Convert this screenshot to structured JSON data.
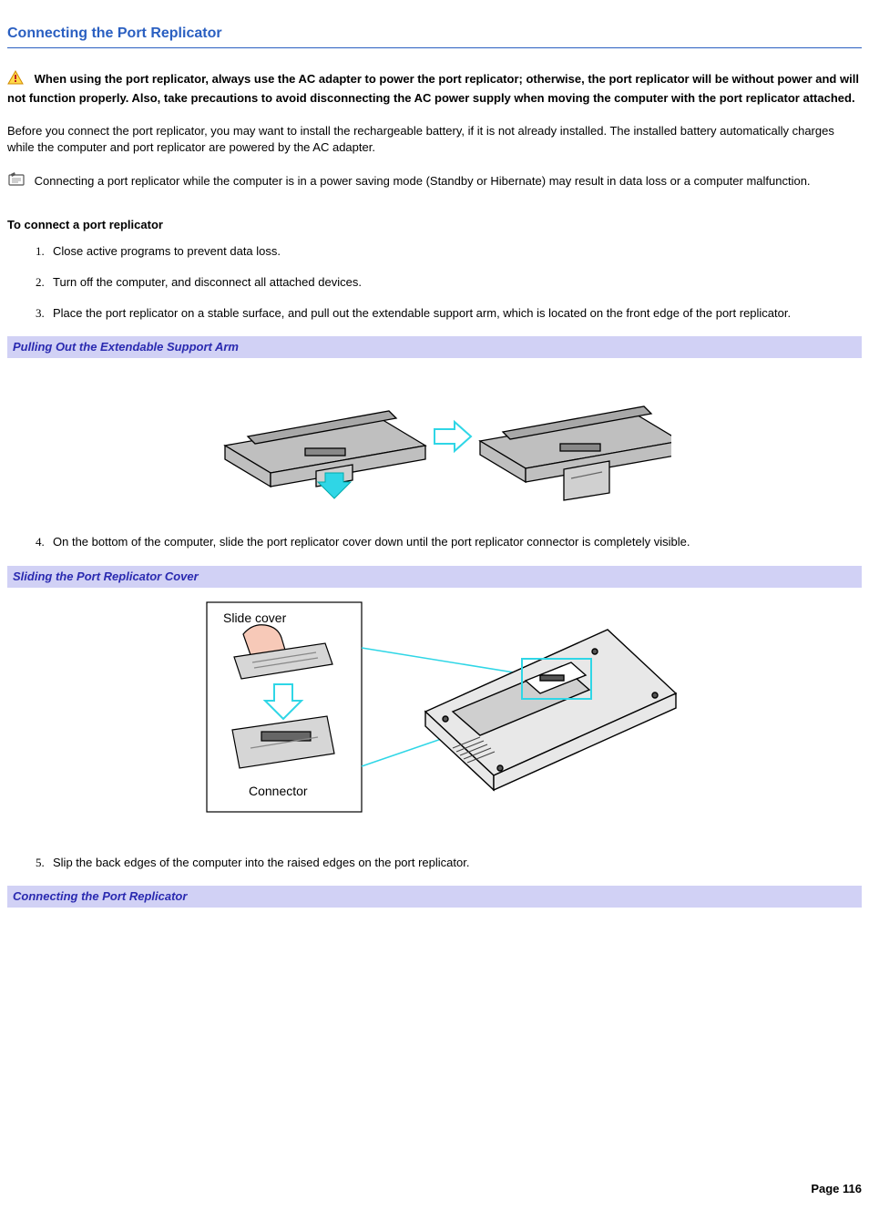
{
  "title": "Connecting the Port Replicator",
  "warning_text": "When using the port replicator, always use the AC adapter to power the port replicator; otherwise, the port replicator will be without power and will not function properly. Also, take precautions to avoid disconnecting the AC power supply when moving the computer with the port replicator attached.",
  "intro_text": "Before you connect the port replicator, you may want to install the rechargeable battery, if it is not already installed. The installed battery automatically charges while the computer and port replicator are powered by the AC adapter.",
  "note_text": "Connecting a port replicator while the computer is in a power saving mode (Standby or Hibernate) may result in data loss or a computer malfunction.",
  "procedure_heading": "To connect a port replicator",
  "steps": [
    "Close active programs to prevent data loss.",
    "Turn off the computer, and disconnect all attached devices.",
    "Place the port replicator on a stable surface, and pull out the extendable support arm, which is located on the front edge of the port replicator.",
    "On the bottom of the computer, slide the port replicator cover down until the port replicator connector is completely visible.",
    "Slip the back edges of the computer into the raised edges on the port replicator."
  ],
  "captions": {
    "fig1": "Pulling Out the Extendable Support Arm",
    "fig2": "Sliding the Port Replicator Cover",
    "fig3": "Connecting the Port Replicator"
  },
  "figure2_labels": {
    "slide": "Slide cover",
    "connector": "Connector"
  },
  "footer": "Page 116"
}
